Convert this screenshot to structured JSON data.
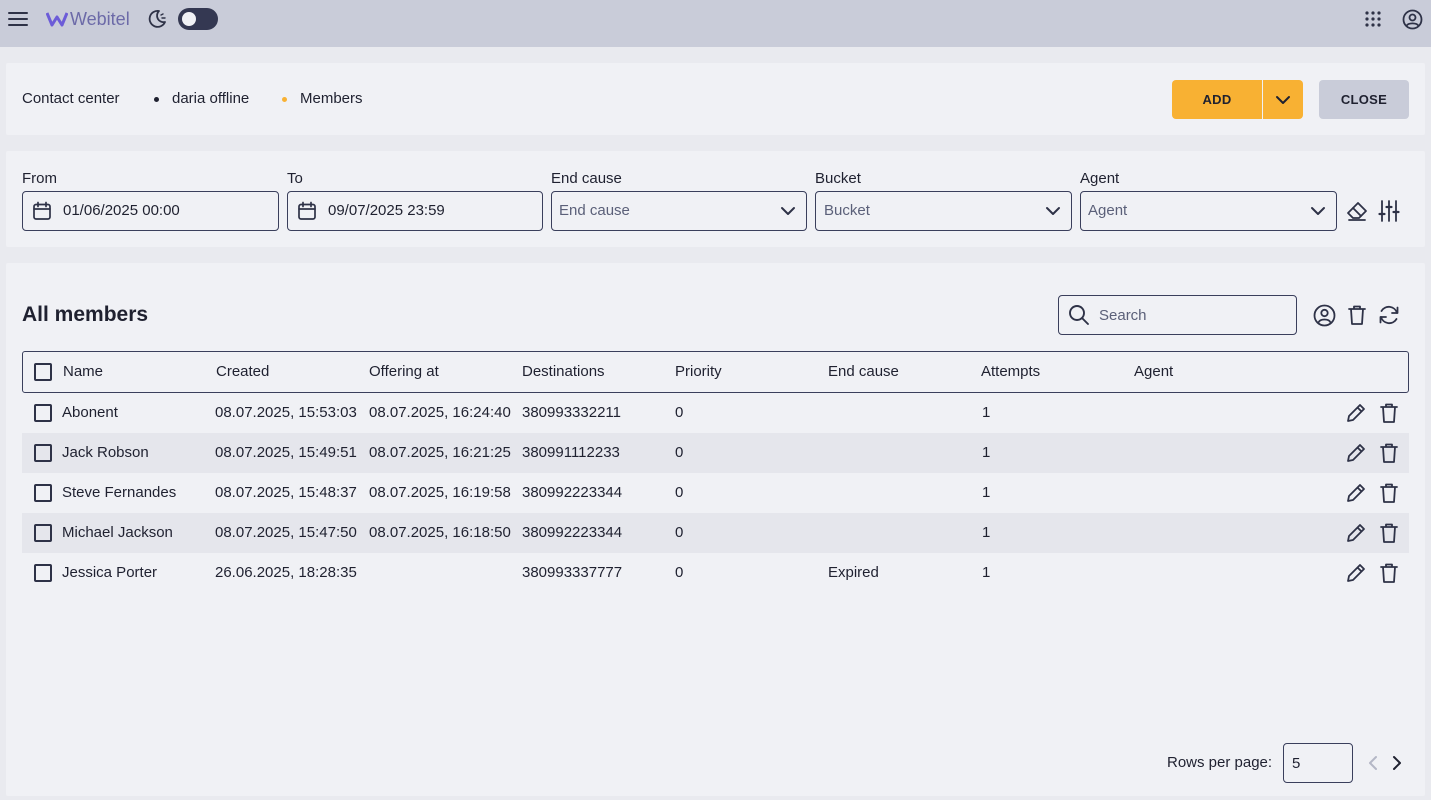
{
  "header": {
    "brand": "Webitel"
  },
  "breadcrumb": {
    "items": [
      "Contact center",
      "daria offline",
      "Members"
    ]
  },
  "actions": {
    "add_label": "ADD",
    "close_label": "CLOSE"
  },
  "filters": {
    "from": {
      "label": "From",
      "value": "01/06/2025 00:00"
    },
    "to": {
      "label": "To",
      "value": "09/07/2025 23:59"
    },
    "end_cause": {
      "label": "End cause",
      "placeholder": "End cause"
    },
    "bucket": {
      "label": "Bucket",
      "placeholder": "Bucket"
    },
    "agent": {
      "label": "Agent",
      "placeholder": "Agent"
    }
  },
  "table": {
    "title": "All members",
    "search_placeholder": "Search",
    "columns": [
      "Name",
      "Created",
      "Offering at",
      "Destinations",
      "Priority",
      "End cause",
      "Attempts",
      "Agent"
    ],
    "rows": [
      [
        "Abonent",
        "08.07.2025, 15:53:03",
        "08.07.2025, 16:24:40",
        "380993332211",
        "0",
        "",
        "1",
        ""
      ],
      [
        "Jack Robson",
        "08.07.2025, 15:49:51",
        "08.07.2025, 16:21:25",
        "380991112233",
        "0",
        "",
        "1",
        ""
      ],
      [
        "Steve Fernandes",
        "08.07.2025, 15:48:37",
        "08.07.2025, 16:19:58",
        "380992223344",
        "0",
        "",
        "1",
        ""
      ],
      [
        "Michael Jackson",
        "08.07.2025, 15:47:50",
        "08.07.2025, 16:18:50",
        "380992223344",
        "0",
        "",
        "1",
        ""
      ],
      [
        "Jessica Porter",
        "26.06.2025, 18:28:35",
        "",
        "380993337777",
        "0",
        "Expired",
        "1",
        ""
      ]
    ]
  },
  "pagination": {
    "rows_per_page_label": "Rows per page:",
    "rows_per_page_value": "5"
  },
  "colors": {
    "accent": "#f8b133",
    "topbar": "#c9ccd9",
    "panel": "#f0f1f5",
    "background": "#e9eaef",
    "border": "#3a3f5c"
  },
  "icons": [
    "menu-icon",
    "webitel-logo-icon",
    "moon-icon",
    "theme-toggle",
    "apps-grid-icon",
    "account-icon",
    "calendar-icon",
    "chevron-down-icon",
    "eraser-icon",
    "filter-settings-icon",
    "search-icon",
    "user-circle-icon",
    "trash-icon",
    "refresh-icon",
    "pencil-icon",
    "chevron-left-icon",
    "chevron-right-icon"
  ]
}
